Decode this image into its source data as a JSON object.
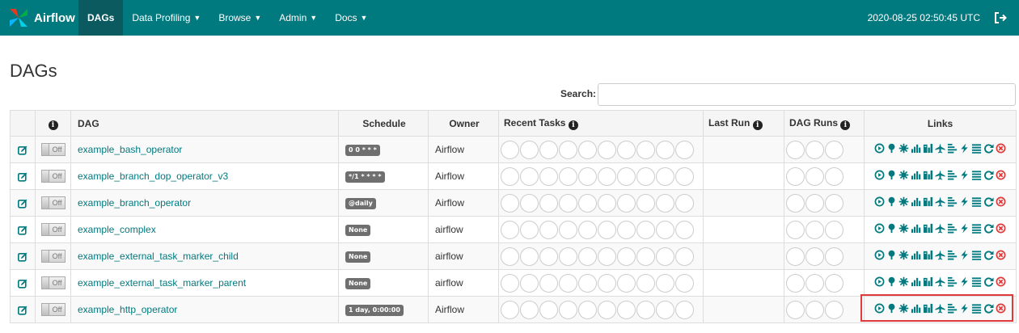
{
  "brand": {
    "name": "Airflow"
  },
  "nav": {
    "items": [
      {
        "label": "DAGs",
        "active": true,
        "caret": false
      },
      {
        "label": "Data Profiling",
        "active": false,
        "caret": true
      },
      {
        "label": "Browse",
        "active": false,
        "caret": true
      },
      {
        "label": "Admin",
        "active": false,
        "caret": true
      },
      {
        "label": "Docs",
        "active": false,
        "caret": true
      }
    ],
    "clock": "2020-08-25 02:50:45 UTC"
  },
  "page_title": "DAGs",
  "search": {
    "label": "Search:",
    "value": ""
  },
  "table": {
    "headers": {
      "dag": "DAG",
      "schedule": "Schedule",
      "owner": "Owner",
      "recent_tasks": "Recent Tasks",
      "last_run": "Last Run",
      "dag_runs": "DAG Runs",
      "links": "Links"
    },
    "rows": [
      {
        "toggle": "Off",
        "dag": "example_bash_operator",
        "schedule": "0 0 * * *",
        "owner": "Airflow"
      },
      {
        "toggle": "Off",
        "dag": "example_branch_dop_operator_v3",
        "schedule": "*/1 * * * *",
        "owner": "Airflow"
      },
      {
        "toggle": "Off",
        "dag": "example_branch_operator",
        "schedule": "@daily",
        "owner": "Airflow"
      },
      {
        "toggle": "Off",
        "dag": "example_complex",
        "schedule": "None",
        "owner": "airflow"
      },
      {
        "toggle": "Off",
        "dag": "example_external_task_marker_child",
        "schedule": "None",
        "owner": "airflow"
      },
      {
        "toggle": "Off",
        "dag": "example_external_task_marker_parent",
        "schedule": "None",
        "owner": "airflow"
      },
      {
        "toggle": "Off",
        "dag": "example_http_operator",
        "schedule": "1 day, 0:00:00",
        "owner": "Airflow"
      }
    ]
  },
  "link_icons": [
    "trigger-dag-icon",
    "tree-view-icon",
    "graph-view-icon",
    "task-duration-icon",
    "task-tries-icon",
    "landing-times-icon",
    "gantt-icon",
    "code-view-icon",
    "logs-icon",
    "refresh-icon",
    "delete-dag-icon"
  ],
  "colors": {
    "navbar": "#00797f",
    "link": "#00797f",
    "delete": "#e03a3a"
  }
}
